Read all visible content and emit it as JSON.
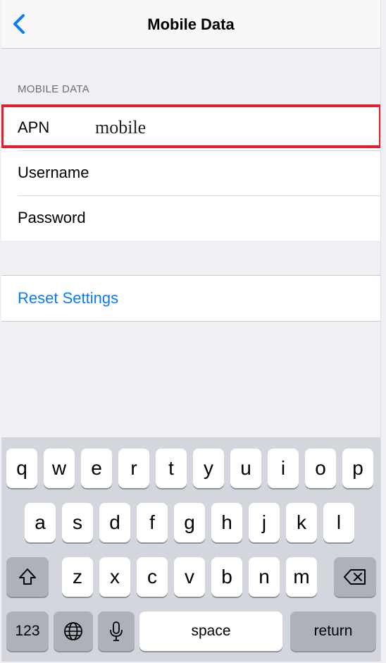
{
  "navbar": {
    "title": "Mobile Data",
    "back_icon": "chevron-left-icon"
  },
  "section": {
    "header": "MOBILE DATA"
  },
  "fields": [
    {
      "label": "APN",
      "value": "mobile"
    },
    {
      "label": "Username",
      "value": ""
    },
    {
      "label": "Password",
      "value": ""
    }
  ],
  "reset": {
    "label": "Reset Settings"
  },
  "keyboard": {
    "row1": [
      "q",
      "w",
      "e",
      "r",
      "t",
      "y",
      "u",
      "i",
      "o",
      "p"
    ],
    "row2": [
      "a",
      "s",
      "d",
      "f",
      "g",
      "h",
      "j",
      "k",
      "l"
    ],
    "row3": [
      "z",
      "x",
      "c",
      "v",
      "b",
      "n",
      "m"
    ],
    "numbers_label": "123",
    "space_label": "space",
    "return_label": "return",
    "icons": {
      "shift": "shift-icon",
      "backspace": "backspace-icon",
      "globe": "globe-icon",
      "mic": "microphone-icon"
    }
  },
  "colors": {
    "accent": "#0a7bf5",
    "highlight": "#e41e2b"
  }
}
